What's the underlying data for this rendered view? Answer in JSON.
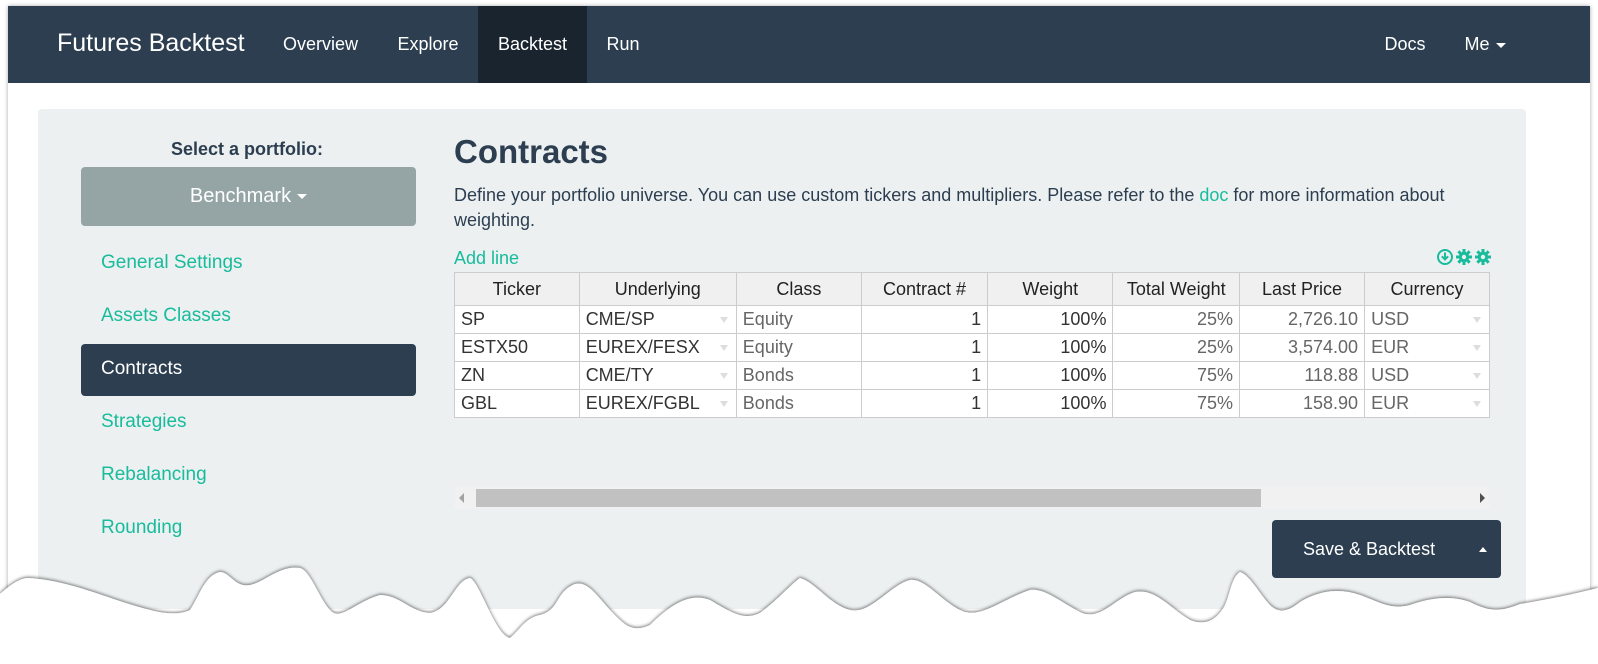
{
  "navbar": {
    "brand": "Futures Backtest",
    "items": [
      {
        "label": "Overview",
        "active": false
      },
      {
        "label": "Explore",
        "active": false
      },
      {
        "label": "Backtest",
        "active": true
      },
      {
        "label": "Run",
        "active": false
      }
    ],
    "right_items": [
      {
        "label": "Docs"
      },
      {
        "label": "Me",
        "icon": "caret-down-icon"
      }
    ]
  },
  "sidebar": {
    "label": "Select a portfolio:",
    "portfolio_selected": "Benchmark",
    "items": [
      {
        "label": "General Settings",
        "active": false
      },
      {
        "label": "Assets Classes",
        "active": false
      },
      {
        "label": "Contracts",
        "active": true
      },
      {
        "label": "Strategies",
        "active": false
      },
      {
        "label": "Rebalancing",
        "active": false
      },
      {
        "label": "Rounding",
        "active": false
      }
    ]
  },
  "content": {
    "title": "Contracts",
    "description_before": "Define your portfolio universe. You can use custom tickers and multipliers. Please refer to the ",
    "description_link": "doc",
    "description_after": " for more information about weighting.",
    "add_line": "Add line",
    "tool_icons": [
      "download-icon",
      "gear-icon",
      "gear-icon"
    ]
  },
  "table": {
    "columns": [
      "Ticker",
      "Underlying",
      "Class",
      "Contract #",
      "Weight",
      "Total Weight",
      "Last Price",
      "Currency"
    ],
    "rows": [
      {
        "ticker": "SP",
        "underlying": "CME/SP",
        "class": "Equity",
        "contracts": "1",
        "weight": "100%",
        "total_weight": "25%",
        "last_price": "2,726.10",
        "currency": "USD"
      },
      {
        "ticker": "ESTX50",
        "underlying": "EUREX/FESX",
        "class": "Equity",
        "contracts": "1",
        "weight": "100%",
        "total_weight": "25%",
        "last_price": "3,574.00",
        "currency": "EUR"
      },
      {
        "ticker": "ZN",
        "underlying": "CME/TY",
        "class": "Bonds",
        "contracts": "1",
        "weight": "100%",
        "total_weight": "75%",
        "last_price": "118.88",
        "currency": "USD"
      },
      {
        "ticker": "GBL",
        "underlying": "EUREX/FGBL",
        "class": "Bonds",
        "contracts": "1",
        "weight": "100%",
        "total_weight": "75%",
        "last_price": "158.90",
        "currency": "EUR"
      }
    ]
  },
  "actions": {
    "save_backtest": "Save & Backtest"
  },
  "colors": {
    "navbar": "#2c3e50",
    "navbar_active": "#1a242f",
    "accent": "#18bc9c",
    "panel": "#ecf0f1",
    "portfolio_button": "#95a5a6"
  }
}
